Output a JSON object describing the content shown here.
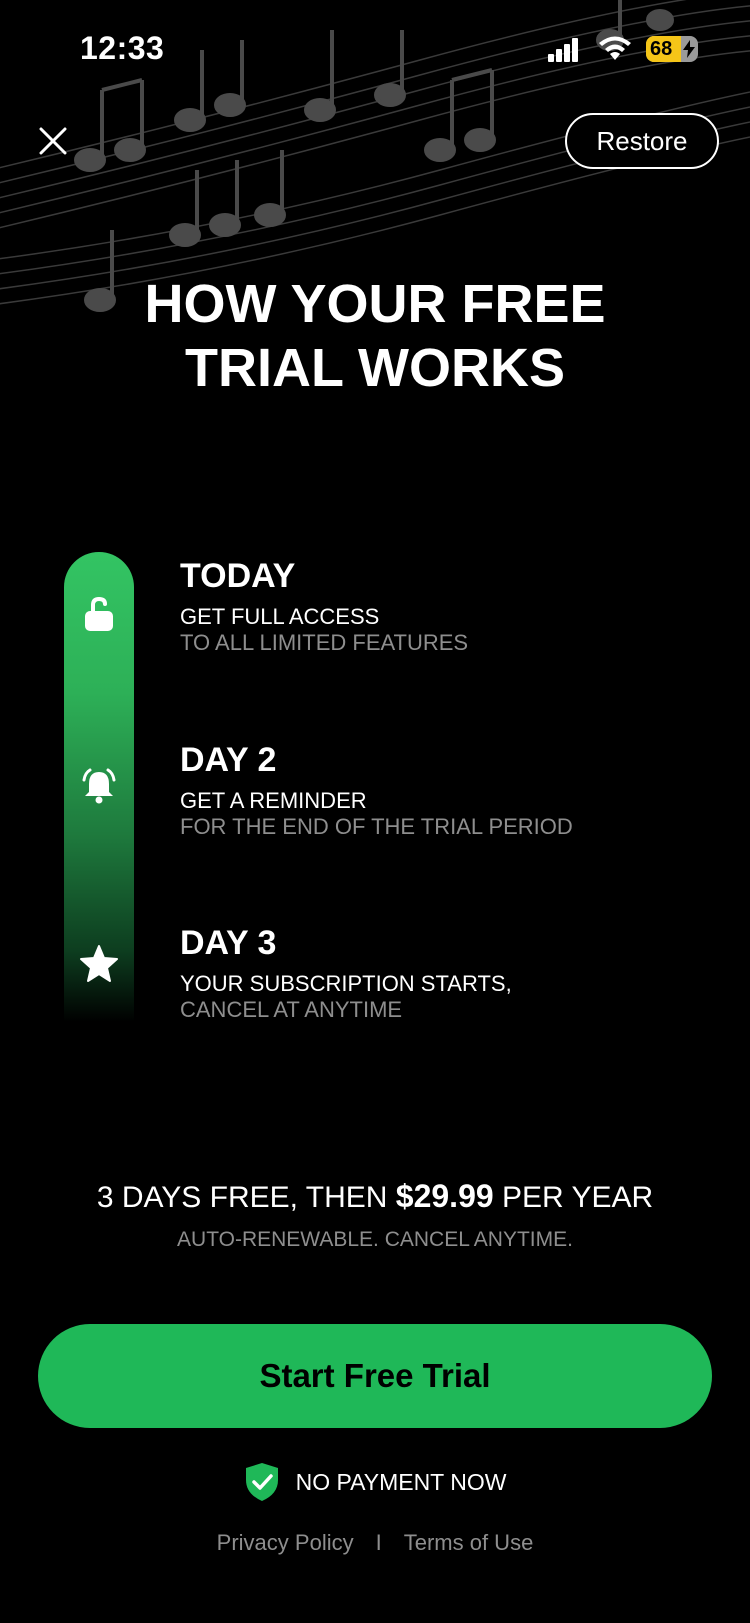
{
  "status_bar": {
    "time": "12:33",
    "battery_level": 68,
    "battery_text": "68"
  },
  "header": {
    "restore_label": "Restore",
    "title_line1": "HOW YOUR FREE",
    "title_line2": "TRIAL WORKS"
  },
  "timeline": [
    {
      "icon": "unlock-icon",
      "title": "TODAY",
      "line1": "GET FULL ACCESS",
      "line2": "TO ALL LIMITED FEATURES"
    },
    {
      "icon": "bell-icon",
      "title": "DAY 2",
      "line1": "GET A REMINDER",
      "line2": "FOR THE END OF THE TRIAL PERIOD"
    },
    {
      "icon": "star-icon",
      "title": "DAY 3",
      "line1": "YOUR SUBSCRIPTION STARTS,",
      "line2": "CANCEL AT ANYTIME"
    }
  ],
  "pricing": {
    "prefix": "3 DAYS FREE, THEN ",
    "price": "$29.99",
    "suffix": " PER YEAR",
    "subtext": "AUTO-RENEWABLE. CANCEL ANYTIME."
  },
  "cta": {
    "label": "Start Free Trial"
  },
  "assurance": {
    "text": "NO PAYMENT NOW"
  },
  "footer": {
    "privacy_label": "Privacy Policy",
    "separator": "I",
    "terms_label": "Terms of Use"
  },
  "colors": {
    "accent": "#1fb858",
    "battery": "#f5c518",
    "muted_text": "#8e8e8e",
    "background": "#000000"
  }
}
